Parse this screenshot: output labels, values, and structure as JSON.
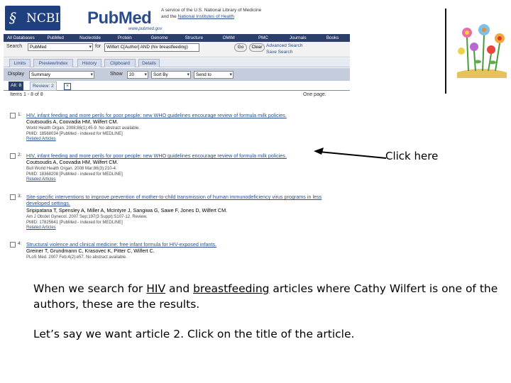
{
  "header": {
    "ncbi_logo": "NCBI",
    "pubmed_logo": "PubMed",
    "pubmed_url": "www.pubmed.gov",
    "service_line1": "A service of the U.S. National Library of Medicine",
    "service_line2_prefix": "and the ",
    "service_line2_link": "National Institutes of Health"
  },
  "db_bar": [
    "All Databases",
    "PubMed",
    "Nucleotide",
    "Protein",
    "Genome",
    "Structure",
    "OMIM",
    "PMC",
    "Journals",
    "Books"
  ],
  "search": {
    "search_label": "Search",
    "db_value": "PubMed",
    "for_label": "for",
    "query": "Wilfert C[Author] AND (hiv breastfeeding)",
    "go_label": "Go",
    "clear_label": "Clear",
    "advanced_label": "Advanced Search",
    "save_label": "Save Search"
  },
  "tabs": [
    "Limits",
    "Preview/Index",
    "History",
    "Clipboard",
    "Details"
  ],
  "display": {
    "display_label": "Display",
    "display_value": "Summary",
    "show_label": "Show",
    "show_value": "20",
    "sort_value": "Sort By",
    "send_value": "Send to"
  },
  "result_tabs": {
    "all": "All: 8",
    "review": "Review: 2",
    "close": "×"
  },
  "items_text": "Items 1 - 8 of 8",
  "onepage_text": "One page.",
  "results": [
    {
      "num": "1:",
      "title": "HIV, infant feeding and more perils for poor people: new WHO guidelines encourage review of formula milk policies.",
      "authors": "Coutsoudis A, Coovadia HM, Wilfert CM.",
      "source": "World Health Organ. 2008;86(1):45-9. No abstract available.",
      "pmid": "PMID: 18568034 [PubMed - indexed for MEDLINE]",
      "related": "Related Articles"
    },
    {
      "num": "2:",
      "title": "HIV, infant feeding and more perils for poor people: new WHO guidelines encourage review of formula milk policies.",
      "authors": "Coutsoudis A, Coovadia HM, Wilfert CM.",
      "source": "Bull World Health Organ. 2008 Mar;86(3):210-4.",
      "pmid": "PMID: 18368208 [PubMed - indexed for MEDLINE]",
      "related": "Related Articles"
    },
    {
      "num": "3:",
      "title": "Site-specific interventions to improve prevention of mother-to-child transmission of human immunodeficiency virus programs in less developed settings.",
      "authors": "Sripipatana T, Spensley A, Miller A, McIntyre J, Sangiwa G, Sawe F, Jones D, Wilfert CM.",
      "source": "Am J Obstet Gynecol. 2007 Sep;197(3 Suppl):S107-12. Review.",
      "pmid": "PMID: 17825641 [PubMed - indexed for MEDLINE]",
      "related": "Related Articles"
    },
    {
      "num": "4:",
      "title": "Structural violence and clinical medicine: free infant formula for HIV-exposed infants.",
      "authors": "Greiner T, Grundmann C, Krasovec K, Pitter C, Wilfert C.",
      "source": "PLoS Med. 2007 Feb;4(2):e57. No abstract available.",
      "pmid": "",
      "related": ""
    }
  ],
  "annotation": {
    "callout": "Click here",
    "caption_p1_a": "When we search for ",
    "caption_hiv": "HIV",
    "caption_p1_b": " and ",
    "caption_bf": "breastfeeding",
    "caption_p1_c": " articles where Cathy Wilfert is one of the authors, these are the results.",
    "caption_p2": "Let’s say we want article 2. Click on the title of the article."
  },
  "colors": {
    "ncbi_blue": "#1f3f7f",
    "link_blue": "#2a4c8a",
    "bar_navy": "#2c3f6b"
  }
}
